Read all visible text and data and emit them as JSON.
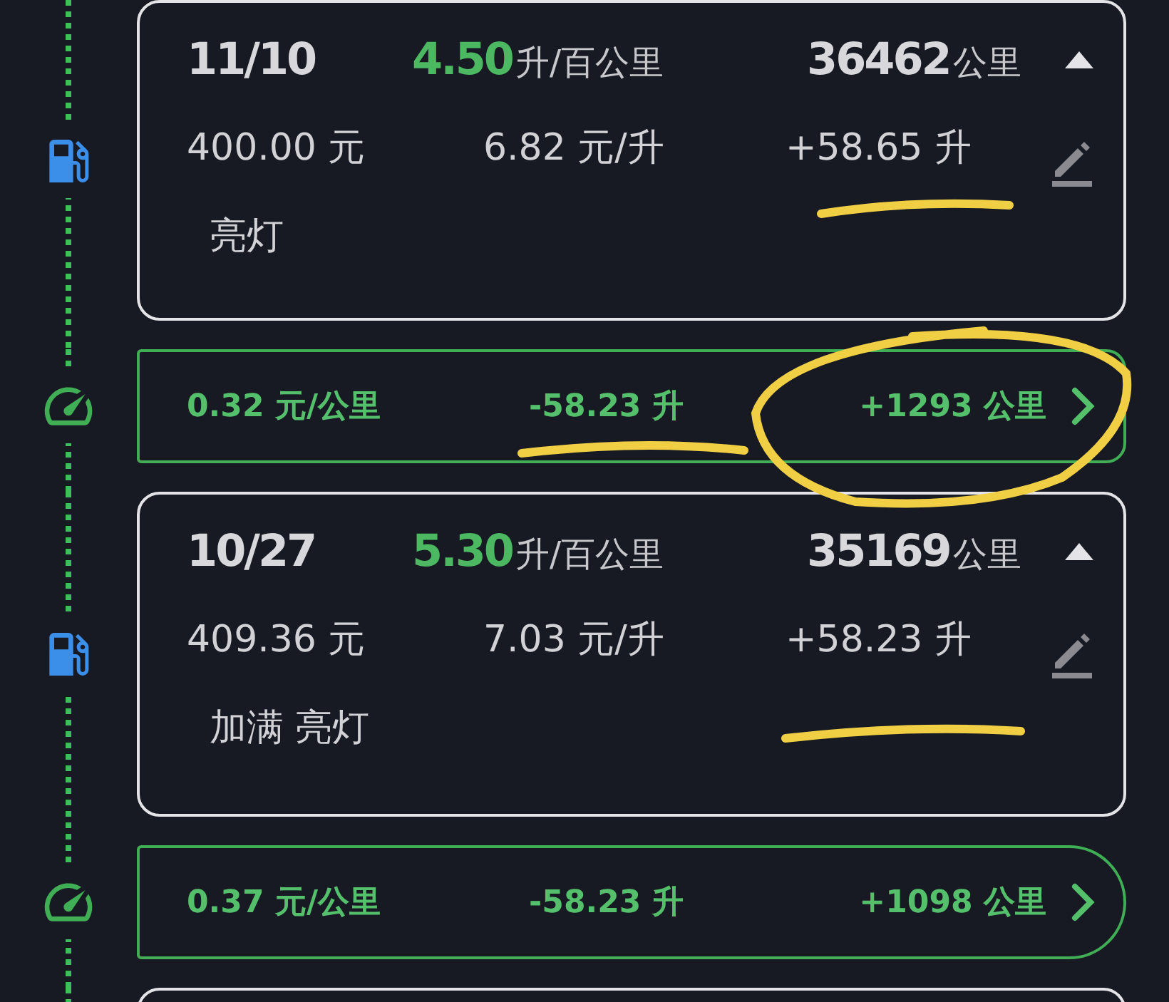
{
  "entries": [
    {
      "kind": "fill",
      "date": "11/10",
      "consumption": "4.50",
      "consumption_unit": "升/百公里",
      "odometer": "36462",
      "odometer_unit": "公里",
      "expanded": true,
      "amount": "400.00 元",
      "price": "6.82 元/升",
      "volume": "+58.65 升",
      "tags": [
        "亮灯"
      ]
    },
    {
      "kind": "trip",
      "cost_per_km": "0.32 元/公里",
      "fuel_used": "-58.23 升",
      "distance": "+1293 公里"
    },
    {
      "kind": "fill",
      "date": "10/27",
      "consumption": "5.30",
      "consumption_unit": "升/百公里",
      "odometer": "35169",
      "odometer_unit": "公里",
      "expanded": true,
      "amount": "409.36 元",
      "price": "7.03 元/升",
      "volume": "+58.23 升",
      "tags": [
        "加满",
        "亮灯"
      ]
    },
    {
      "kind": "trip",
      "cost_per_km": "0.37 元/公里",
      "fuel_used": "-58.23 升",
      "distance": "+1098 公里"
    }
  ]
}
